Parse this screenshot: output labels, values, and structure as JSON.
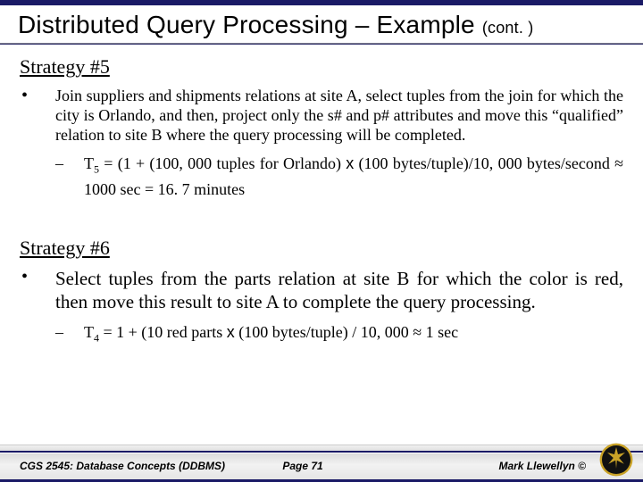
{
  "title": {
    "main": "Distributed Query Processing – Example",
    "cont": "(cont. )"
  },
  "strategy5": {
    "heading": "Strategy #5",
    "bullet": "Join suppliers and shipments relations at site A, select tuples from the join for which the city is Orlando, and then, project only the s# and p# attributes and move this “qualified” relation to site B where the query processing will be completed.",
    "formula_pre": "T",
    "formula_sub": "5",
    "formula_post": " = (1 + (100, 000 tuples for Orlando) ",
    "formula_x": "x",
    "formula_tail": " (100 bytes/tuple)/10, 000 bytes/second ≈ 1000 sec = 16. 7 minutes"
  },
  "strategy6": {
    "heading": "Strategy #6",
    "bullet": "Select tuples from the parts relation at site B for which the color is red,  then move this result to site A to complete the query processing.",
    "formula_pre": "T",
    "formula_sub": "4",
    "formula_post": " = 1 + (10 red parts ",
    "formula_x": "x",
    "formula_tail": " (100 bytes/tuple) / 10, 000 ≈ 1 sec"
  },
  "footer": {
    "left": "CGS 2545: Database Concepts  (DDBMS)",
    "mid": "Page 71",
    "right": "Mark Llewellyn ©"
  },
  "glyph": {
    "bullet": "•",
    "dash": "–"
  }
}
